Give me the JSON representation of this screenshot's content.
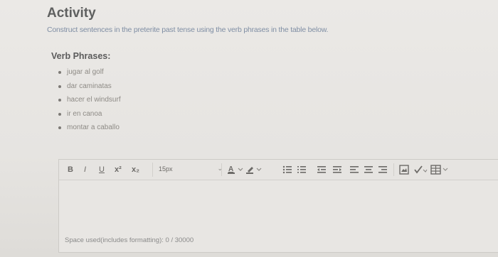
{
  "activity": {
    "title": "Activity",
    "instructions": "Construct sentences in the preterite past tense using the verb phrases in the table below."
  },
  "verb_section": {
    "heading": "Verb Phrases:",
    "items": [
      "jugar al golf",
      "dar caminatas",
      "hacer el windsurf",
      "ir en canoa",
      "montar a caballo"
    ]
  },
  "editor": {
    "toolbar": {
      "bold": "B",
      "italic": "I",
      "underline": "U",
      "superscript": "x²",
      "subscript": "x₂",
      "font_size": "15px"
    },
    "status": "Space used(includes formatting): 0 / 30000"
  }
}
